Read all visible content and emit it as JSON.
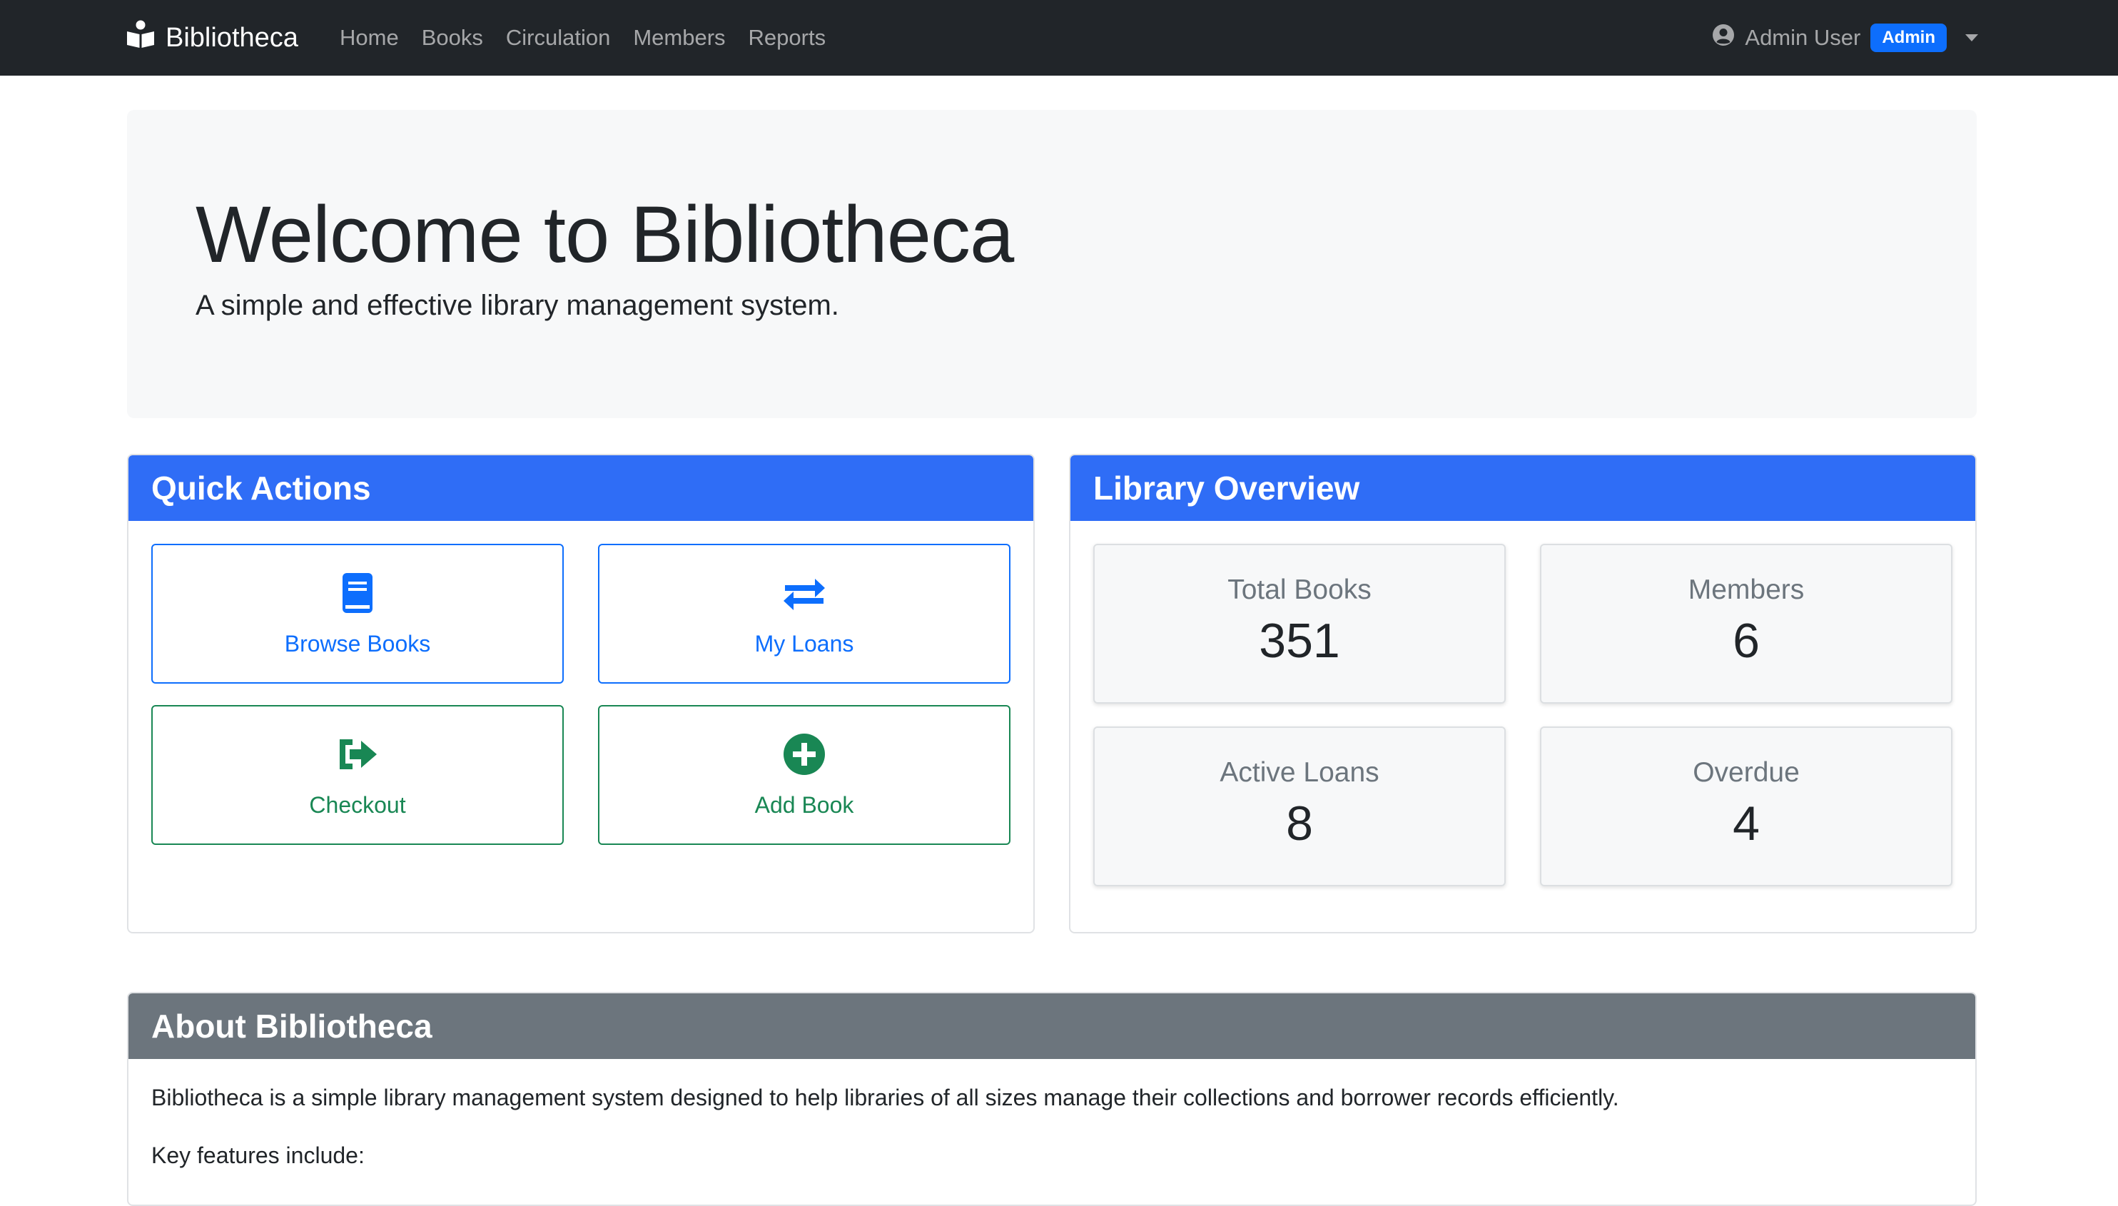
{
  "brand": {
    "name": "Bibliotheca"
  },
  "nav": [
    {
      "label": "Home"
    },
    {
      "label": "Books"
    },
    {
      "label": "Circulation"
    },
    {
      "label": "Members"
    },
    {
      "label": "Reports"
    }
  ],
  "user": {
    "name": "Admin User",
    "role": "Admin"
  },
  "hero": {
    "title": "Welcome to Bibliotheca",
    "subtitle": "A simple and effective library management system."
  },
  "quick_actions": {
    "title": "Quick Actions",
    "items": [
      {
        "label": "Browse Books",
        "icon": "book-icon",
        "color": "#0d6efd"
      },
      {
        "label": "My Loans",
        "icon": "exchange-icon",
        "color": "#0d6efd"
      },
      {
        "label": "Checkout",
        "icon": "sign-out-icon",
        "color": "#198754"
      },
      {
        "label": "Add Book",
        "icon": "plus-circle-icon",
        "color": "#198754"
      }
    ]
  },
  "overview": {
    "title": "Library Overview",
    "stats": [
      {
        "label": "Total Books",
        "value": "351"
      },
      {
        "label": "Members",
        "value": "6"
      },
      {
        "label": "Active Loans",
        "value": "8"
      },
      {
        "label": "Overdue",
        "value": "4"
      }
    ]
  },
  "about": {
    "title": "About Bibliotheca",
    "description": "Bibliotheca is a simple library management system designed to help libraries of all sizes manage their collections and borrower records efficiently.",
    "features_heading": "Key features include:"
  },
  "colors": {
    "navbar": "#212529",
    "primary": "#0d6efd",
    "header_primary": "#2f6df6",
    "success": "#198754",
    "secondary": "#6c757d"
  }
}
